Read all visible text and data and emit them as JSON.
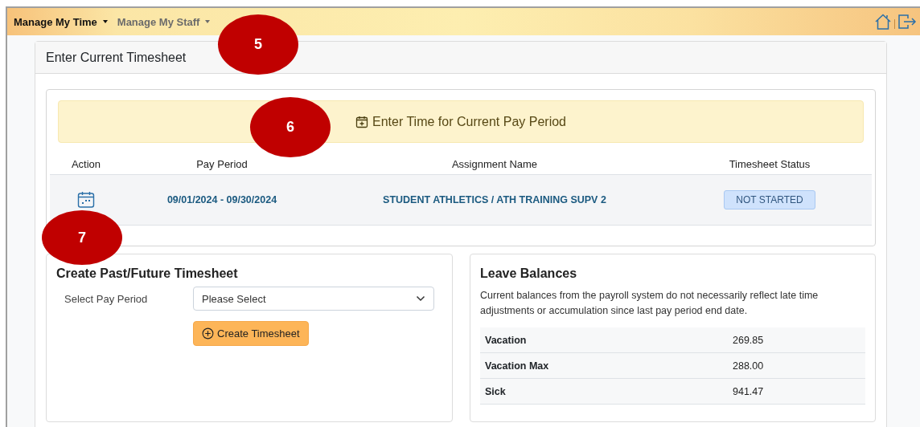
{
  "nav": {
    "menus": [
      {
        "label": "Manage My Time",
        "selected": true
      },
      {
        "label": "Manage My Staff",
        "selected": false
      }
    ]
  },
  "card": {
    "title": "Enter Current Timesheet",
    "banner": "Enter Time for Current Pay Period",
    "columns": [
      "Action",
      "Pay Period",
      "Assignment Name",
      "Timesheet Status"
    ],
    "rows": [
      {
        "pay_period": "09/01/2024 - 09/30/2024",
        "assignment": "STUDENT ATHLETICS / ATH TRAINING SUPV 2",
        "status": "NOT STARTED"
      }
    ]
  },
  "create": {
    "title": "Create Past/Future Timesheet",
    "label": "Select Pay Period",
    "select": {
      "value": "Please Select"
    },
    "button": "Create Timesheet"
  },
  "leave": {
    "title": "Leave Balances",
    "note": "Current balances from the payroll system do not necessarily reflect late time adjustments or accumulation since last pay period end date.",
    "rows": [
      {
        "name": "Vacation",
        "value": "269.85"
      },
      {
        "name": "Vacation Max",
        "value": "288.00"
      },
      {
        "name": "Sick",
        "value": "941.47"
      }
    ]
  },
  "callouts": [
    "5",
    "6",
    "7"
  ]
}
